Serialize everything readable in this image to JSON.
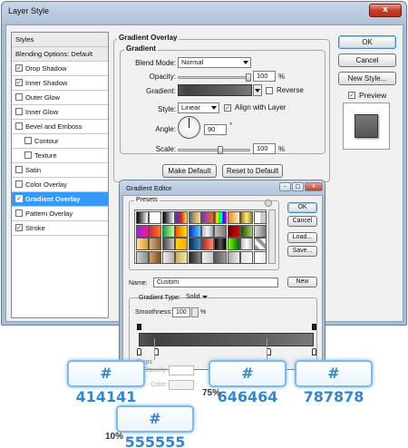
{
  "window": {
    "title": "Layer Style",
    "close": "x"
  },
  "styles_list": [
    {
      "label": "Styles",
      "type": "header"
    },
    {
      "label": "Blending Options: Default",
      "type": "header"
    },
    {
      "label": "Drop Shadow",
      "checked": true
    },
    {
      "label": "Inner Shadow",
      "checked": true
    },
    {
      "label": "Outer Glow",
      "checked": false
    },
    {
      "label": "Inner Glow",
      "checked": false
    },
    {
      "label": "Bevel and Emboss",
      "checked": false
    },
    {
      "label": "Contour",
      "checked": false,
      "indent": true
    },
    {
      "label": "Texture",
      "checked": false,
      "indent": true
    },
    {
      "label": "Satin",
      "checked": false
    },
    {
      "label": "Color Overlay",
      "checked": false
    },
    {
      "label": "Gradient Overlay",
      "checked": true,
      "selected": true
    },
    {
      "label": "Pattern Overlay",
      "checked": false
    },
    {
      "label": "Stroke",
      "checked": true
    }
  ],
  "gradient_overlay": {
    "section_title": "Gradient Overlay",
    "group_title": "Gradient",
    "blend_mode_label": "Blend Mode:",
    "blend_mode_value": "Normal",
    "opacity_label": "Opacity:",
    "opacity_value": "100",
    "percent": "%",
    "gradient_label": "Gradient:",
    "reverse_label": "Reverse",
    "style_label": "Style:",
    "style_value": "Linear",
    "align_label": "Align with Layer",
    "angle_label": "Angle:",
    "angle_value": "90",
    "degree": "°",
    "scale_label": "Scale:",
    "scale_value": "100",
    "make_default": "Make Default",
    "reset_default": "Reset to Default"
  },
  "right_buttons": {
    "ok": "OK",
    "cancel": "Cancel",
    "new_style": "New Style...",
    "preview": "Preview"
  },
  "gradient_editor": {
    "title": "Gradient Editor",
    "presets_label": "Presets",
    "ok": "OK",
    "cancel": "Cancel",
    "load": "Load...",
    "save": "Save...",
    "name_label": "Name:",
    "name_value": "Custom",
    "new_button": "New",
    "type_label": "Gradient Type:",
    "type_value": "Solid",
    "smoothness_label": "Smoothness:",
    "smoothness_value": "100",
    "percent": "%",
    "stops_label": "Stops",
    "opacity_label": "Opacity:",
    "color_label": "Color:",
    "stops": [
      {
        "color": "#555555",
        "location": 0
      },
      {
        "color": "#414141",
        "location": 10
      },
      {
        "color": "#646464",
        "location": 75
      },
      {
        "color": "#787878",
        "location": 100
      }
    ]
  },
  "callouts": {
    "c1": "# 414141",
    "c2": "# 646464",
    "c3": "# 787878",
    "c4": "# 555555",
    "p75": "75%",
    "p10": "10%"
  },
  "colors": {
    "accent": "#3399ff",
    "callout_text": "#2f87d8",
    "callout_border": "#7fb8ea"
  }
}
